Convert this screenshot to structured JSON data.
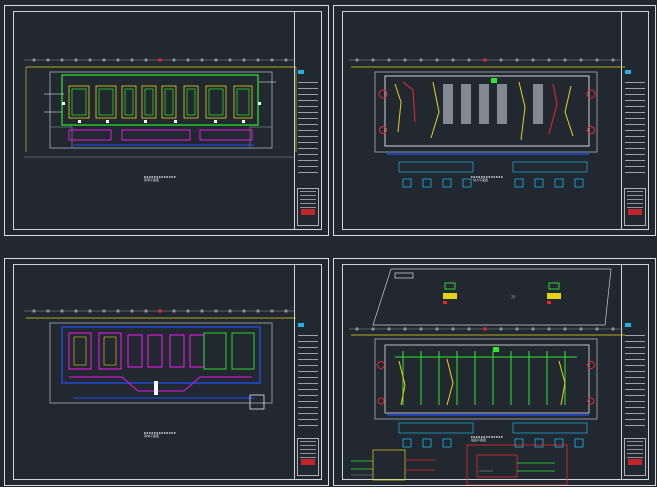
{
  "colors": {
    "background": "#212830",
    "border": "#d9dde2",
    "green": "#2ee82e",
    "magenta": "#e619e6",
    "blue": "#2050ff",
    "red": "#e82828",
    "yellow": "#e6d21a",
    "cyan": "#1ab4e6",
    "gray": "#8a939b"
  },
  "sheets": [
    {
      "id": "sheet-1",
      "caption": "照明平面图"
    },
    {
      "id": "sheet-2",
      "caption": "动力平面图"
    },
    {
      "id": "sheet-3",
      "caption": "弱电平面图"
    },
    {
      "id": "sheet-4",
      "caption": "插座平面图"
    }
  ],
  "detail_text": "??"
}
